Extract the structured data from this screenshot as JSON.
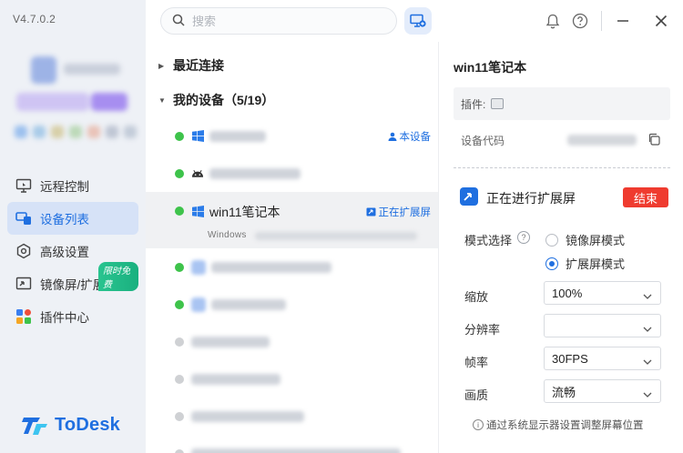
{
  "app": {
    "version": "V4.7.0.2",
    "logo_text": "ToDesk"
  },
  "sidebar": {
    "items": [
      {
        "label": "远程控制",
        "icon": "monitor-remote-icon",
        "active": false
      },
      {
        "label": "设备列表",
        "icon": "device-list-icon",
        "active": true
      },
      {
        "label": "高级设置",
        "icon": "gear-icon",
        "active": false
      },
      {
        "label": "镜像屏/扩展屏",
        "icon": "screen-mirror-icon",
        "active": false,
        "badge": "限时免费"
      },
      {
        "label": "插件中心",
        "icon": "plugin-grid-icon",
        "active": false
      }
    ]
  },
  "topbar": {
    "search_placeholder": "搜索"
  },
  "devices": {
    "recent_label": "最近连接",
    "my_devices_label": "我的设备（5/19）",
    "this_device_tag": "本设备",
    "extending_tag": "正在扩展屏",
    "selected_name": "win11笔记本",
    "selected_os": "Windows"
  },
  "panel": {
    "title": "win11笔记本",
    "plugin_label": "插件:",
    "device_code_label": "设备代码",
    "extend_status": "正在进行扩展屏",
    "end_button": "结束",
    "mode_label": "模式选择",
    "mode_mirror": "镜像屏模式",
    "mode_extend": "扩展屏模式",
    "scale_label": "缩放",
    "scale_value": "100%",
    "resolution_label": "分辨率",
    "resolution_value": "",
    "framerate_label": "帧率",
    "framerate_value": "30FPS",
    "quality_label": "画质",
    "quality_value": "流畅",
    "tip": "通过系统显示器设置调整屏幕位置"
  },
  "colors": {
    "accent": "#1f6fe0",
    "online": "#3ec34b",
    "danger": "#ef3b2f"
  }
}
